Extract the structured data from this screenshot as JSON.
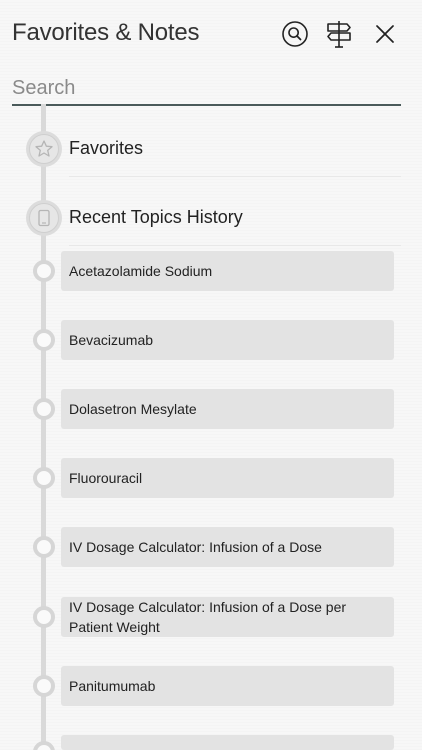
{
  "header": {
    "title": "Favorites & Notes",
    "icons": {
      "search": "search-icon",
      "signpost": "signpost-icon",
      "close": "close-icon"
    }
  },
  "search": {
    "placeholder": "Search",
    "value": ""
  },
  "sections": {
    "favorites": {
      "label": "Favorites",
      "icon": "star-icon"
    },
    "recent": {
      "label": "Recent Topics History",
      "icon": "tablet-icon"
    }
  },
  "recent_items": [
    "Acetazolamide Sodium",
    "Bevacizumab",
    "Dolasetron Mesylate",
    "Fluorouracil",
    "IV Dosage Calculator: Infusion of a Dose",
    "IV Dosage Calculator: Infusion of a Dose per Patient Weight",
    "Panitumumab",
    ""
  ],
  "colors": {
    "background": "#f7f7f7",
    "card": "#e3e3e3",
    "timeline": "#d9d9d9",
    "search_underline": "#4a5a5a"
  }
}
